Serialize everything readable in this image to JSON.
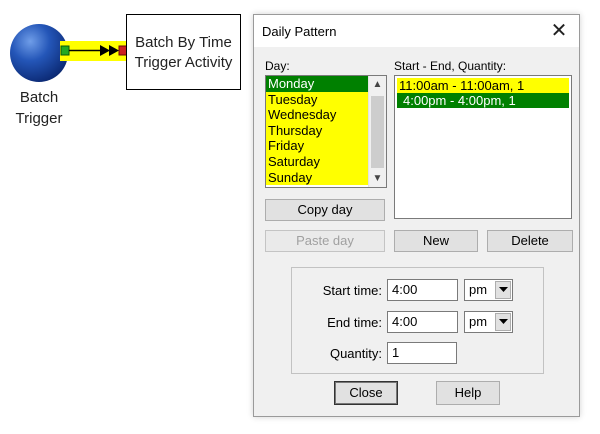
{
  "diagram": {
    "source_node": {
      "label_line1": "Batch",
      "label_line2": "Trigger"
    },
    "target_node": {
      "label_line1": "Batch By Time",
      "label_line2": "Trigger Activity"
    }
  },
  "dialog": {
    "title": "Daily Pattern",
    "day_label": "Day:",
    "days": [
      {
        "label": "Monday",
        "selected": true
      },
      {
        "label": "Tuesday",
        "selected": false
      },
      {
        "label": "Wednesday",
        "selected": false
      },
      {
        "label": "Thursday",
        "selected": false
      },
      {
        "label": "Friday",
        "selected": false
      },
      {
        "label": "Saturday",
        "selected": false
      },
      {
        "label": "Sunday",
        "selected": false
      }
    ],
    "schedule_label": "Start - End, Quantity:",
    "schedule": [
      {
        "label": "11:00am - 11:00am, 1",
        "selected": false
      },
      {
        "label": "4:00pm - 4:00pm, 1",
        "selected": true
      }
    ],
    "buttons": {
      "copy_day": "Copy day",
      "paste_day": "Paste day",
      "new": "New",
      "delete": "Delete",
      "close": "Close",
      "help": "Help"
    },
    "fields": {
      "start_time_label": "Start time:",
      "start_time": "4:00",
      "start_ampm": "pm",
      "end_time_label": "End time:",
      "end_time": "4:00",
      "end_ampm": "pm",
      "quantity_label": "Quantity:",
      "quantity": "1"
    }
  },
  "colors": {
    "highlight": "#ffff00",
    "selection": "#008000",
    "node_blue": "#1b47a8",
    "connector_green": "#22aa22",
    "connector_red": "#cc2222"
  }
}
